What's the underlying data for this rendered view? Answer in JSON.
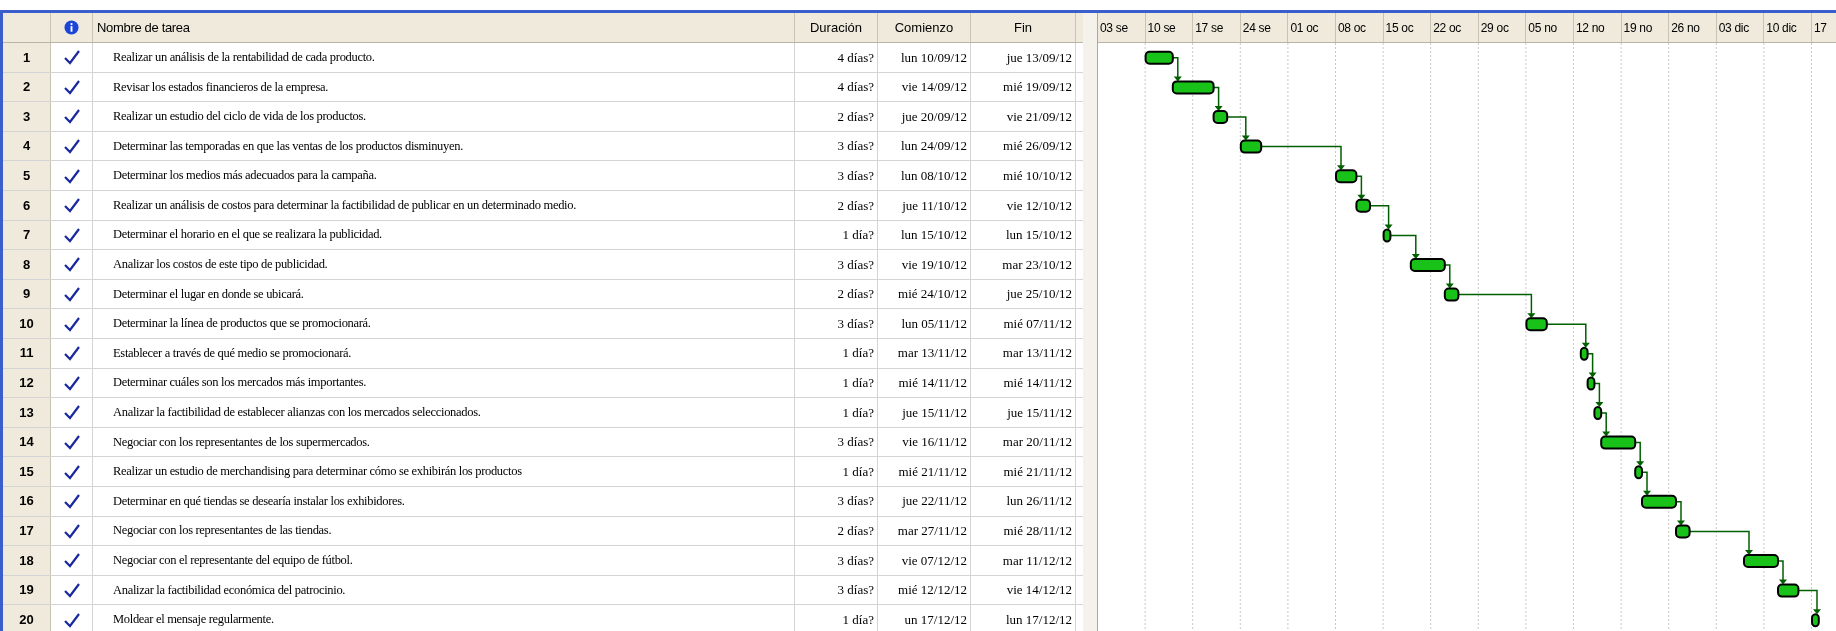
{
  "table": {
    "columns": [
      "Nombre de tarea",
      "Duración",
      "Comienzo",
      "Fin"
    ],
    "rows": [
      {
        "id": "1",
        "complete": true,
        "name": "Realizar un análisis de la rentabilidad de cada producto.",
        "duration": "4 días?",
        "start": "lun 10/09/12",
        "end": "jue 13/09/12"
      },
      {
        "id": "2",
        "complete": true,
        "name": "Revisar los estados financieros de la empresa.",
        "duration": "4 días?",
        "start": "vie 14/09/12",
        "end": "mié 19/09/12"
      },
      {
        "id": "3",
        "complete": true,
        "name": "Realizar un estudio del ciclo de vida de los productos.",
        "duration": "2 días?",
        "start": "jue 20/09/12",
        "end": "vie 21/09/12"
      },
      {
        "id": "4",
        "complete": true,
        "name": "Determinar las temporadas en que las ventas de los productos disminuyen.",
        "duration": "3 días?",
        "start": "lun 24/09/12",
        "end": "mié 26/09/12"
      },
      {
        "id": "5",
        "complete": true,
        "name": "Determinar los medios más adecuados para la campaña.",
        "duration": "3 días?",
        "start": "lun 08/10/12",
        "end": "mié 10/10/12"
      },
      {
        "id": "6",
        "complete": true,
        "name": "Realizar un análisis de costos para determinar la factibilidad de publicar en un determinado medio.",
        "duration": "2 días?",
        "start": "jue 11/10/12",
        "end": "vie 12/10/12"
      },
      {
        "id": "7",
        "complete": true,
        "name": "Determinar el horario en el que se realizara la publicidad.",
        "duration": "1 día?",
        "start": "lun 15/10/12",
        "end": "lun 15/10/12"
      },
      {
        "id": "8",
        "complete": true,
        "name": "Analizar los costos de este tipo de publicidad.",
        "duration": "3 días?",
        "start": "vie 19/10/12",
        "end": "mar 23/10/12"
      },
      {
        "id": "9",
        "complete": true,
        "name": "Determinar el lugar en donde se ubicará.",
        "duration": "2 días?",
        "start": "mié 24/10/12",
        "end": "jue 25/10/12"
      },
      {
        "id": "10",
        "complete": true,
        "name": "Determinar la línea de productos que se promocionará.",
        "duration": "3 días?",
        "start": "lun 05/11/12",
        "end": "mié 07/11/12"
      },
      {
        "id": "11",
        "complete": true,
        "name": "Establecer a través de qué medio se promocionará.",
        "duration": "1 día?",
        "start": "mar 13/11/12",
        "end": "mar 13/11/12"
      },
      {
        "id": "12",
        "complete": true,
        "name": "Determinar cuáles son los mercados más importantes.",
        "duration": "1 día?",
        "start": "mié 14/11/12",
        "end": "mié 14/11/12"
      },
      {
        "id": "13",
        "complete": true,
        "name": "Analizar la factibilidad de establecer alianzas con los mercados seleccionados.",
        "duration": "1 día?",
        "start": "jue 15/11/12",
        "end": "jue 15/11/12"
      },
      {
        "id": "14",
        "complete": true,
        "name": "Negociar con los representantes de los supermercados.",
        "duration": "3 días?",
        "start": "vie 16/11/12",
        "end": "mar 20/11/12"
      },
      {
        "id": "15",
        "complete": true,
        "name": "Realizar un estudio de merchandising para determinar cómo se exhibirán los productos",
        "duration": "1 día?",
        "start": "mié 21/11/12",
        "end": "mié 21/11/12"
      },
      {
        "id": "16",
        "complete": true,
        "name": "Determinar en qué tiendas se desearía instalar los exhibidores.",
        "duration": "3 días?",
        "start": "jue 22/11/12",
        "end": "lun 26/11/12"
      },
      {
        "id": "17",
        "complete": true,
        "name": "Negociar con los representantes de las tiendas.",
        "duration": "2 días?",
        "start": "mar 27/11/12",
        "end": "mié 28/11/12"
      },
      {
        "id": "18",
        "complete": true,
        "name": "Negociar con el representante del equipo de fútbol.",
        "duration": "3 días?",
        "start": "vie 07/12/12",
        "end": "mar 11/12/12"
      },
      {
        "id": "19",
        "complete": true,
        "name": "Analizar la factibilidad  económica del patrocinio.",
        "duration": "3 días?",
        "start": "mié 12/12/12",
        "end": "vie 14/12/12"
      },
      {
        "id": "20",
        "complete": true,
        "name": "Moldear el mensaje regularmente.",
        "duration": "1 día?",
        "start": "un 17/12/12",
        "end": "lun 17/12/12"
      }
    ]
  },
  "timeline": {
    "weeks": [
      "03 se",
      "10 se",
      "17 se",
      "24 se",
      "01 oc",
      "08 oc",
      "15 oc",
      "22 oc",
      "29 oc",
      "05 no",
      "12 no",
      "19 no",
      "26 no",
      "03 dic",
      "10 dic",
      "17"
    ]
  }
}
